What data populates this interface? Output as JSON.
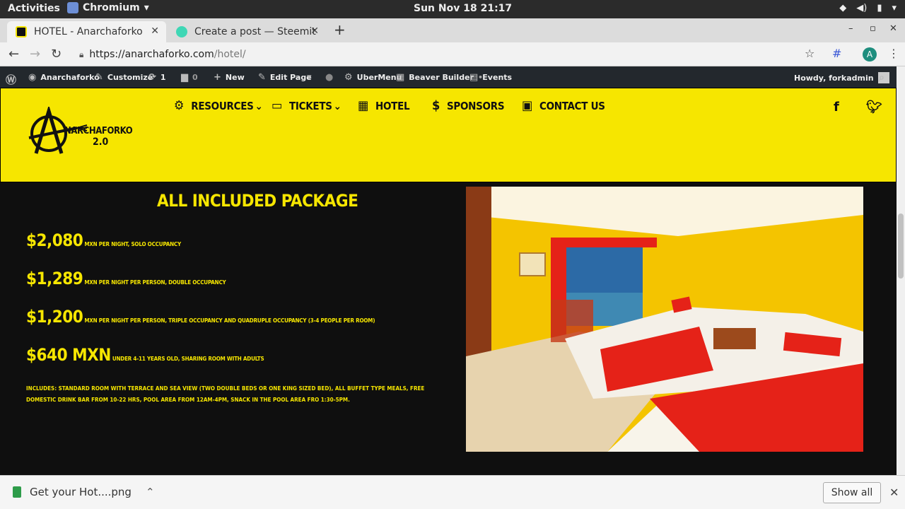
{
  "os_bar": {
    "activities": "Activities",
    "app_name": "Chromium",
    "clock": "Sun Nov 18  21:17"
  },
  "browser": {
    "tabs": [
      {
        "title": "HOTEL - Anarchaforko"
      },
      {
        "title": "Create a post — Steemit"
      }
    ],
    "url_host": "https://anarchaforko.com",
    "url_path": "/hotel/",
    "profile_initial": "A"
  },
  "wp_admin": {
    "site_name": "Anarchaforko",
    "customize": "Customize",
    "updates_count": "1",
    "comments_count": "0",
    "new": "New",
    "edit_page": "Edit Page",
    "ubermenu": "UberMenu",
    "beaver_builder": "Beaver Builder",
    "events": "Events",
    "howdy": "Howdy, forkadmin"
  },
  "site": {
    "logo_text": "NARCHAFORKO",
    "logo_version": "2.0",
    "nav": [
      {
        "label": "RESOURCES",
        "icon": "gears-icon"
      },
      {
        "label": "TICKETS",
        "icon": "ticket-icon"
      },
      {
        "label": "HOTEL",
        "icon": "building-icon"
      },
      {
        "label": "SPONSORS",
        "icon": "donate-icon"
      },
      {
        "label": "CONTACT US",
        "icon": "id-card-icon"
      }
    ],
    "package_title": "ALL INCLUDED PACKAGE",
    "prices": [
      {
        "amount": "$2,080",
        "desc": "MXN PER NIGHT, SOLO OCCUPANCY"
      },
      {
        "amount": "$1,289",
        "desc": "MXN PER NIGHT PER PERSON, DOUBLE OCCUPANCY"
      },
      {
        "amount": "$1,200",
        "desc": "MXN PER NIGHT PER PERSON, TRIPLE OCCUPANCY AND QUADRUPLE OCCUPANCY (3-4 PEOPLE PER ROOM)"
      },
      {
        "amount": "$640 MXN",
        "desc": "UNDER 4-11 YEARS OLD, SHARING ROOM WITH ADULTS"
      }
    ],
    "includes": "INCLUDES: STANDARD ROOM WITH TERRACE AND SEA VIEW (TWO DOUBLE BEDS OR ONE KING SIZED BED), ALL BUFFET TYPE MEALS, FREE DOMESTIC DRINK BAR FROM 10-22 HRS, POOL AREA FROM 12AM-4PM, SNACK IN THE POOL AREA FRO 1:30-5PM."
  },
  "downloads": {
    "file": "Get your Hot....png",
    "show_all": "Show all"
  },
  "colors": {
    "brand_yellow": "#f6e600",
    "dark_bg": "#0f0f0f"
  }
}
